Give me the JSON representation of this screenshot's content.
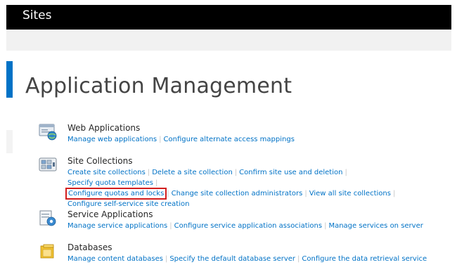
{
  "header": {
    "title": "Sites"
  },
  "page": {
    "title": "Application Management"
  },
  "sections": [
    {
      "title": "Web Applications",
      "icon": "web-applications-icon",
      "links": [
        "Manage web applications",
        "Configure alternate access mappings"
      ]
    },
    {
      "title": "Site Collections",
      "icon": "site-collections-icon",
      "links": [
        "Create site collections",
        "Delete a site collection",
        "Confirm site use and deletion",
        "Specify quota templates",
        "Configure quotas and locks",
        "Change site collection administrators",
        "View all site collections",
        "Configure self-service site creation"
      ]
    },
    {
      "title": "Service Applications",
      "icon": "service-applications-icon",
      "links": [
        "Manage service applications",
        "Configure service application associations",
        "Manage services on server"
      ]
    },
    {
      "title": "Databases",
      "icon": "databases-icon",
      "links": [
        "Manage content databases",
        "Specify the default database server",
        "Configure the data retrieval service"
      ]
    }
  ],
  "colors": {
    "accent": "#0072c6",
    "link": "#0072c6",
    "highlight_border": "#d21d1d",
    "header_bg": "#000000"
  }
}
